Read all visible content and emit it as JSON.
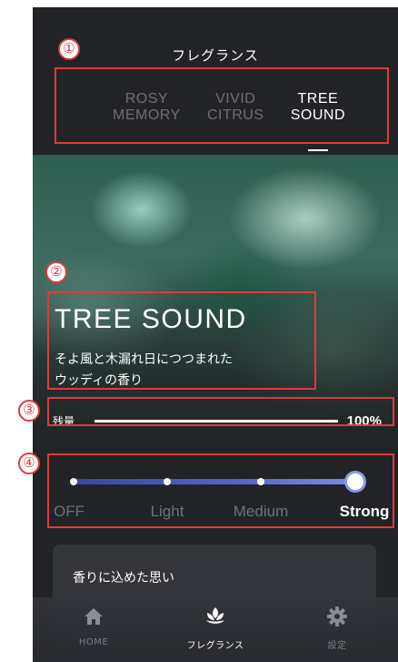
{
  "header": {
    "title": "フレグランス"
  },
  "tabs": [
    {
      "line1": "ROSY",
      "line2": "MEMORY",
      "active": false
    },
    {
      "line1": "VIVID",
      "line2": "CITRUS",
      "active": false
    },
    {
      "line1": "TREE",
      "line2": "SOUND",
      "active": true
    }
  ],
  "fragrance": {
    "name": "TREE SOUND",
    "description_line1": "そよ風と木漏れ日につつまれた",
    "description_line2": "ウッディの香り"
  },
  "remaining": {
    "label": "残量",
    "value_text": "100%",
    "level_fraction": 1.0
  },
  "intensity": {
    "options": [
      "OFF",
      "Light",
      "Medium",
      "Strong"
    ],
    "selected": "Strong",
    "accent": "#5566c9"
  },
  "card": {
    "title": "香りに込めた思い"
  },
  "nav": {
    "items": [
      {
        "label": "HOME",
        "icon": "home-icon",
        "active": false
      },
      {
        "label": "フレグランス",
        "icon": "fragrance-leaf-icon",
        "active": true
      },
      {
        "label": "設定",
        "icon": "gear-icon",
        "active": false
      }
    ]
  },
  "annotations": [
    "①",
    "②",
    "③",
    "④"
  ],
  "colors": {
    "annotation": "#e03a3a",
    "background": "#222326"
  }
}
